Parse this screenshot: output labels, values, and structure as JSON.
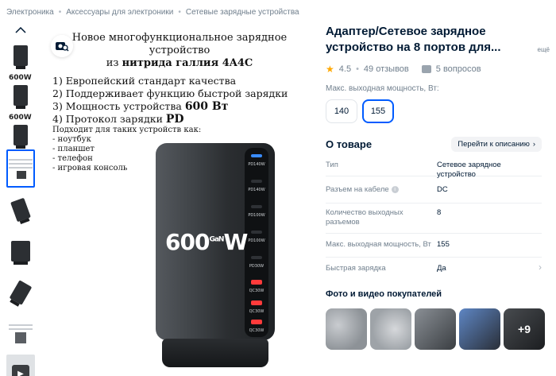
{
  "breadcrumb": [
    "Электроника",
    "Аксессуары для электроники",
    "Сетевые зарядные устройства"
  ],
  "thumbnails": {
    "labels": [
      "600W",
      "600W"
    ],
    "active_index": 3
  },
  "image": {
    "title_line1": "Новое многофункциональное зарядное устройство",
    "title_line2_pre": "из ",
    "title_line2_bold": "нитрида галлия 4A4C",
    "list": [
      {
        "pre": "1) Европейский стандарт качества",
        "bold": ""
      },
      {
        "pre": "2) Поддерживает функцию быстрой зарядки",
        "bold": ""
      },
      {
        "pre": "3) Мощность устройства ",
        "bold": "600 Вт"
      },
      {
        "pre": "4) Протокол зарядки ",
        "bold": "PD"
      }
    ],
    "suitable_title": "Подходит для таких устройств как:",
    "suitable": [
      "- ноутбук",
      "- планшет",
      "- телефон",
      "- игровая консоль"
    ],
    "brand": "600",
    "brand_sup": "GaN",
    "brand_w": "W",
    "ports": [
      "PD140W",
      "PD140W",
      "PD100W",
      "PD100W",
      "PD30W",
      "QC30W",
      "QC30W",
      "QC30W"
    ]
  },
  "product": {
    "title": "Адаптер/Сетевое зарядное устройство на 8 портов для...",
    "more_label": "ещё",
    "rating": "4.5",
    "reviews": "49 отзывов",
    "questions": "5 вопросов",
    "option_label": "Макс. выходная мощность, Вт:",
    "options": [
      "140",
      "155"
    ],
    "selected_option": "155"
  },
  "about": {
    "title": "О товаре",
    "goto_label": "Перейти к описанию",
    "specs": [
      {
        "k": "Тип",
        "v": "Сетевое зарядное устройство"
      },
      {
        "k": "Разъем на кабеле",
        "v": "DC"
      },
      {
        "k": "Количество выходных разъемов",
        "v": "8"
      },
      {
        "k": "Макс. выходная мощность, Вт",
        "v": "155"
      },
      {
        "k": "Быстрая зарядка",
        "v": "Да"
      }
    ]
  },
  "photos": {
    "title": "Фото и видео покупателей",
    "more_count": "+9"
  },
  "colors": {
    "accent": "#005bff",
    "text": "#001a34",
    "muted": "#707f8d",
    "star": "#ffa800"
  }
}
